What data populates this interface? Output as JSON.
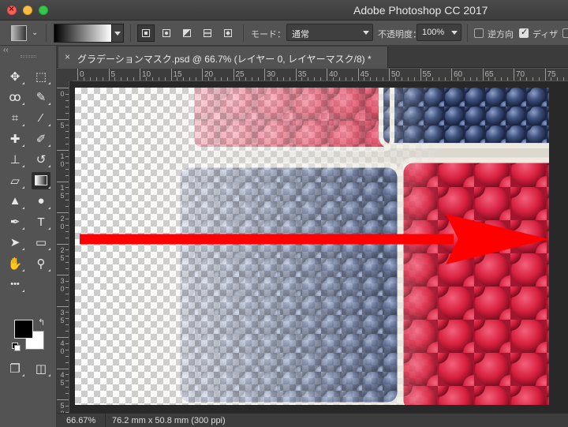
{
  "window": {
    "title": "Adobe Photoshop CC 2017"
  },
  "options_bar": {
    "tool_icon": "gradient-tool-icon",
    "gradient_preset": "black-white",
    "gradient_types": [
      "linear",
      "radial",
      "angle",
      "reflected",
      "diamond"
    ],
    "active_gradient_type": "linear",
    "mode_label": "モード：",
    "mode_value": "通常",
    "opacity_label": "不透明度：",
    "opacity_value": "100%",
    "reverse_label": "逆方向",
    "reverse_checked": false,
    "dither_label": "ディザ",
    "dither_checked": true
  },
  "document_tab": {
    "close_symbol": "×",
    "title": "グラデーションマスク.psd @ 66.7% (レイヤー 0, レイヤーマスク/8) *"
  },
  "ruler": {
    "top_labels": [
      "0",
      "5",
      "10",
      "15",
      "20",
      "25",
      "30",
      "35",
      "40",
      "45",
      "50",
      "55",
      "60",
      "65",
      "70",
      "75"
    ],
    "left_labels": [
      "0",
      "5",
      "1\n0",
      "1\n5",
      "2\n0",
      "2\n5",
      "3\n0",
      "3\n5",
      "4\n0",
      "4\n5",
      "5\n0"
    ]
  },
  "tools": [
    {
      "name": "move-tool",
      "glyph": "✥",
      "active": false
    },
    {
      "name": "marquee-tool",
      "glyph": "⬚",
      "active": false
    },
    {
      "name": "lasso-tool",
      "glyph": "ꝏ",
      "active": false
    },
    {
      "name": "quick-selection-tool",
      "glyph": "✎",
      "active": false
    },
    {
      "name": "crop-tool",
      "glyph": "⌗",
      "active": false
    },
    {
      "name": "eyedropper-tool",
      "glyph": "⁄",
      "active": false
    },
    {
      "name": "healing-brush-tool",
      "glyph": "✚",
      "active": false
    },
    {
      "name": "brush-tool",
      "glyph": "✐",
      "active": false
    },
    {
      "name": "stamp-tool",
      "glyph": "⊥",
      "active": false
    },
    {
      "name": "history-brush-tool",
      "glyph": "↺",
      "active": false
    },
    {
      "name": "eraser-tool",
      "glyph": "▱",
      "active": false
    },
    {
      "name": "gradient-tool",
      "glyph": "",
      "active": true
    },
    {
      "name": "blur-tool",
      "glyph": "▲",
      "active": false
    },
    {
      "name": "dodge-tool",
      "glyph": "●",
      "active": false
    },
    {
      "name": "pen-tool",
      "glyph": "✒",
      "active": false
    },
    {
      "name": "type-tool",
      "glyph": "T",
      "active": false
    },
    {
      "name": "path-selection-tool",
      "glyph": "➤",
      "active": false
    },
    {
      "name": "shape-tool",
      "glyph": "▭",
      "active": false
    },
    {
      "name": "hand-tool",
      "glyph": "✋",
      "active": false
    },
    {
      "name": "zoom-tool",
      "glyph": "⚲",
      "active": false
    },
    {
      "name": "more-tools",
      "glyph": "•••",
      "active": false
    },
    {
      "name": "quick-mask-mode",
      "glyph": "◫",
      "active": false
    },
    {
      "name": "screen-mode",
      "glyph": "❐",
      "active": false
    }
  ],
  "colors": {
    "foreground": "#000000",
    "background": "#ffffff",
    "arrow": "#ff0000"
  },
  "status_bar": {
    "zoom": "66.67%",
    "doc_info": "76.2 mm x 50.8 mm (300 ppi)"
  }
}
